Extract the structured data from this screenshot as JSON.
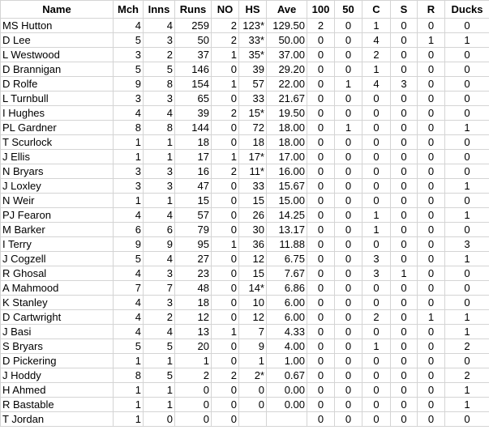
{
  "columns": [
    "Name",
    "Mch",
    "Inns",
    "Runs",
    "NO",
    "HS",
    "Ave",
    "100",
    "50",
    "C",
    "S",
    "R",
    "Ducks"
  ],
  "rows": [
    [
      "MS Hutton",
      "4",
      "4",
      "259",
      "2",
      "123*",
      "129.50",
      "2",
      "0",
      "1",
      "0",
      "0",
      "0"
    ],
    [
      "D Lee",
      "5",
      "3",
      "50",
      "2",
      "33*",
      "50.00",
      "0",
      "0",
      "4",
      "0",
      "1",
      "1"
    ],
    [
      "L Westwood",
      "3",
      "2",
      "37",
      "1",
      "35*",
      "37.00",
      "0",
      "0",
      "2",
      "0",
      "0",
      "0"
    ],
    [
      "D Brannigan",
      "5",
      "5",
      "146",
      "0",
      "39",
      "29.20",
      "0",
      "0",
      "1",
      "0",
      "0",
      "0"
    ],
    [
      "D Rolfe",
      "9",
      "8",
      "154",
      "1",
      "57",
      "22.00",
      "0",
      "1",
      "4",
      "3",
      "0",
      "0"
    ],
    [
      "L Turnbull",
      "3",
      "3",
      "65",
      "0",
      "33",
      "21.67",
      "0",
      "0",
      "0",
      "0",
      "0",
      "0"
    ],
    [
      "I Hughes",
      "4",
      "4",
      "39",
      "2",
      "15*",
      "19.50",
      "0",
      "0",
      "0",
      "0",
      "0",
      "0"
    ],
    [
      "PL Gardner",
      "8",
      "8",
      "144",
      "0",
      "72",
      "18.00",
      "0",
      "1",
      "0",
      "0",
      "0",
      "1"
    ],
    [
      "T Scurlock",
      "1",
      "1",
      "18",
      "0",
      "18",
      "18.00",
      "0",
      "0",
      "0",
      "0",
      "0",
      "0"
    ],
    [
      "J Ellis",
      "1",
      "1",
      "17",
      "1",
      "17*",
      "17.00",
      "0",
      "0",
      "0",
      "0",
      "0",
      "0"
    ],
    [
      "N Bryars",
      "3",
      "3",
      "16",
      "2",
      "11*",
      "16.00",
      "0",
      "0",
      "0",
      "0",
      "0",
      "0"
    ],
    [
      "J Loxley",
      "3",
      "3",
      "47",
      "0",
      "33",
      "15.67",
      "0",
      "0",
      "0",
      "0",
      "0",
      "1"
    ],
    [
      "N Weir",
      "1",
      "1",
      "15",
      "0",
      "15",
      "15.00",
      "0",
      "0",
      "0",
      "0",
      "0",
      "0"
    ],
    [
      "PJ Fearon",
      "4",
      "4",
      "57",
      "0",
      "26",
      "14.25",
      "0",
      "0",
      "1",
      "0",
      "0",
      "1"
    ],
    [
      "M Barker",
      "6",
      "6",
      "79",
      "0",
      "30",
      "13.17",
      "0",
      "0",
      "1",
      "0",
      "0",
      "0"
    ],
    [
      "I Terry",
      "9",
      "9",
      "95",
      "1",
      "36",
      "11.88",
      "0",
      "0",
      "0",
      "0",
      "0",
      "3"
    ],
    [
      "J Cogzell",
      "5",
      "4",
      "27",
      "0",
      "12",
      "6.75",
      "0",
      "0",
      "3",
      "0",
      "0",
      "1"
    ],
    [
      "R Ghosal",
      "4",
      "3",
      "23",
      "0",
      "15",
      "7.67",
      "0",
      "0",
      "3",
      "1",
      "0",
      "0"
    ],
    [
      "A Mahmood",
      "7",
      "7",
      "48",
      "0",
      "14*",
      "6.86",
      "0",
      "0",
      "0",
      "0",
      "0",
      "0"
    ],
    [
      "K Stanley",
      "4",
      "3",
      "18",
      "0",
      "10",
      "6.00",
      "0",
      "0",
      "0",
      "0",
      "0",
      "0"
    ],
    [
      "D Cartwright",
      "4",
      "2",
      "12",
      "0",
      "12",
      "6.00",
      "0",
      "0",
      "2",
      "0",
      "1",
      "1"
    ],
    [
      "J Basi",
      "4",
      "4",
      "13",
      "1",
      "7",
      "4.33",
      "0",
      "0",
      "0",
      "0",
      "0",
      "1"
    ],
    [
      "S Bryars",
      "5",
      "5",
      "20",
      "0",
      "9",
      "4.00",
      "0",
      "0",
      "1",
      "0",
      "0",
      "2"
    ],
    [
      "D Pickering",
      "1",
      "1",
      "1",
      "0",
      "1",
      "1.00",
      "0",
      "0",
      "0",
      "0",
      "0",
      "0"
    ],
    [
      "J Hoddy",
      "8",
      "5",
      "2",
      "2",
      "2*",
      "0.67",
      "0",
      "0",
      "0",
      "0",
      "0",
      "2"
    ],
    [
      "H Ahmed",
      "1",
      "1",
      "0",
      "0",
      "0",
      "0.00",
      "0",
      "0",
      "0",
      "0",
      "0",
      "1"
    ],
    [
      "R Bastable",
      "1",
      "1",
      "0",
      "0",
      "0",
      "0.00",
      "0",
      "0",
      "0",
      "0",
      "0",
      "1"
    ],
    [
      "T Jordan",
      "1",
      "0",
      "0",
      "0",
      "",
      "",
      "0",
      "0",
      "0",
      "0",
      "0",
      "0"
    ]
  ]
}
